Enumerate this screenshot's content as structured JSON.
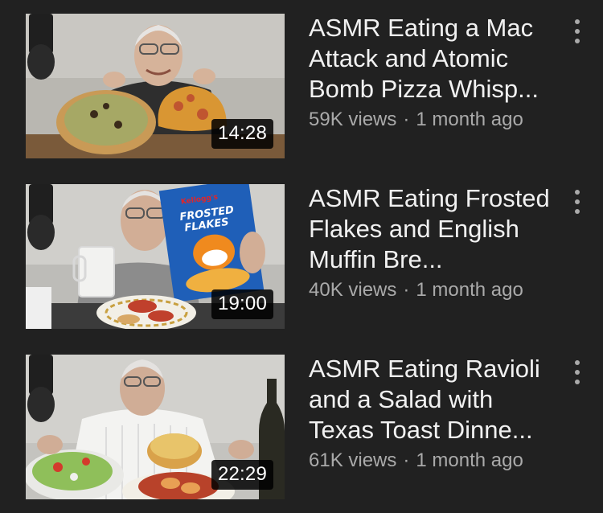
{
  "colors": {
    "background": "#212121",
    "title_text": "#f1f1f1",
    "meta_text": "#aaaaaa",
    "duration_badge": "#000000"
  },
  "videos": [
    {
      "title": "ASMR Eating a Mac Attack and Atomic Bomb Pizza Whisp...",
      "duration": "14:28",
      "views": "59K views",
      "age": "1 month ago",
      "menu_icon": "more-vert-icon"
    },
    {
      "title": "ASMR Eating Frosted Flakes and English Muffin Bre...",
      "duration": "19:00",
      "views": "40K views",
      "age": "1 month ago",
      "menu_icon": "more-vert-icon",
      "box_brand": "Kellogg's",
      "box_name_line1": "FROSTED",
      "box_name_line2": "FLAKES"
    },
    {
      "title": "ASMR Eating Ravioli and a Salad with Texas Toast Dinne...",
      "duration": "22:29",
      "views": "61K views",
      "age": "1 month ago",
      "menu_icon": "more-vert-icon"
    }
  ]
}
